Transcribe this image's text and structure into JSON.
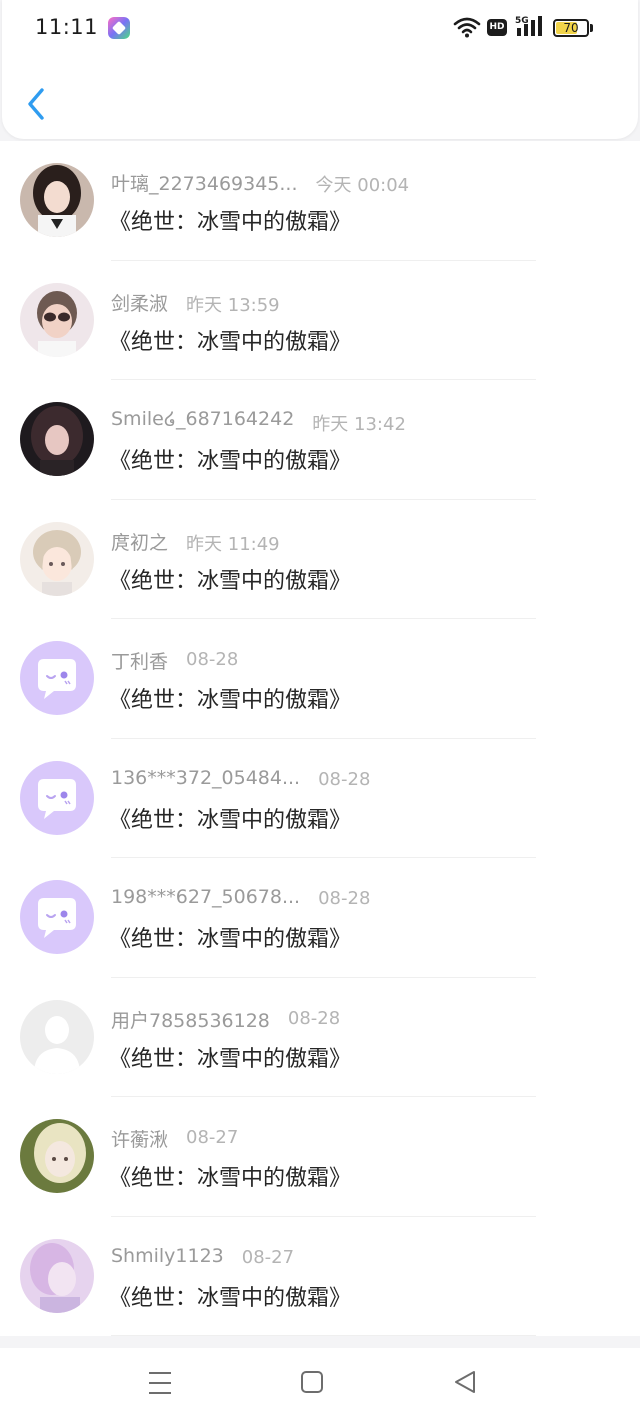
{
  "status_bar": {
    "time": "11:11",
    "battery_level": "70",
    "battery_fraction": 0.7,
    "icons": [
      "app-badge-icon",
      "wifi-icon",
      "hd-icon",
      "5g-signal-icon",
      "battery-icon"
    ],
    "signal_label": "5G",
    "hd_label": "HD"
  },
  "header": {
    "back_icon": "chevron-left-icon",
    "accent_color": "#2f9cf0"
  },
  "colors": {
    "placeholder_avatar_bg": "#d9c8fb",
    "default_avatar_bg": "#ededed",
    "name_color": "#9a9a9a",
    "time_color": "#b4b4b4",
    "message_color": "#262626"
  },
  "messages": [
    {
      "name": "叶璃_2273469345...",
      "time": "今天 00:04",
      "text": "《绝世：冰雪中的傲霜》",
      "avatar": "photo-dark-hair"
    },
    {
      "name": "剑柔淑",
      "time": "昨天 13:59",
      "text": "《绝世：冰雪中的傲霜》",
      "avatar": "photo-sunglasses"
    },
    {
      "name": "Smile໒_687164242",
      "time": "昨天 13:42",
      "text": "《绝世：冰雪中的傲霜》",
      "avatar": "photo-dark-portrait"
    },
    {
      "name": "庹初之",
      "time": "昨天 11:49",
      "text": "《绝世：冰雪中的傲霜》",
      "avatar": "anime-light-hair"
    },
    {
      "name": "丁利香",
      "time": "08-28",
      "text": "《绝世：冰雪中的傲霜》",
      "avatar": "chat-bubble-placeholder"
    },
    {
      "name": "136***372_05484...",
      "time": "08-28",
      "text": "《绝世：冰雪中的傲霜》",
      "avatar": "chat-bubble-placeholder"
    },
    {
      "name": "198***627_50678...",
      "time": "08-28",
      "text": "《绝世：冰雪中的傲霜》",
      "avatar": "chat-bubble-placeholder"
    },
    {
      "name": "用户7858536128",
      "time": "08-28",
      "text": "《绝世：冰雪中的傲霜》",
      "avatar": "default-person-placeholder"
    },
    {
      "name": "许蘅湫",
      "time": "08-27",
      "text": "《绝世：冰雪中的傲霜》",
      "avatar": "photo-light-hair"
    },
    {
      "name": "Shmily1123",
      "time": "08-27",
      "text": "《绝世：冰雪中的傲霜》",
      "avatar": "photo-pink-tint"
    }
  ],
  "nav_bar": {
    "buttons": [
      "menu-icon",
      "home-square-icon",
      "back-triangle-icon"
    ]
  }
}
